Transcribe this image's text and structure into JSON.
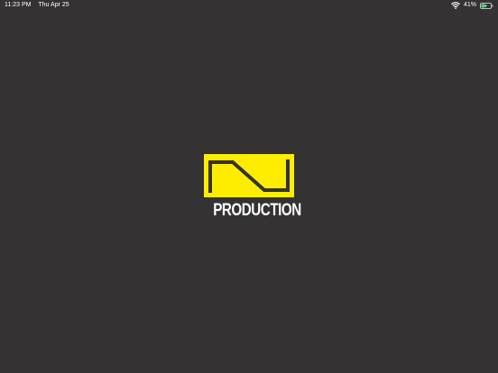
{
  "status_bar": {
    "time": "11:23 PM",
    "date": "Thu Apr 25",
    "battery_percent_label": "41%",
    "battery_level": 0.41,
    "wifi_icon": "wifi-icon",
    "battery_icon": "battery-charging-icon"
  },
  "splash": {
    "logo_icon": "n-production-logo-mark",
    "logo_text": "PRODUCTION",
    "logo_color": "#FFED00",
    "logo_stroke_color": "#343232",
    "background_color": "#343232"
  }
}
